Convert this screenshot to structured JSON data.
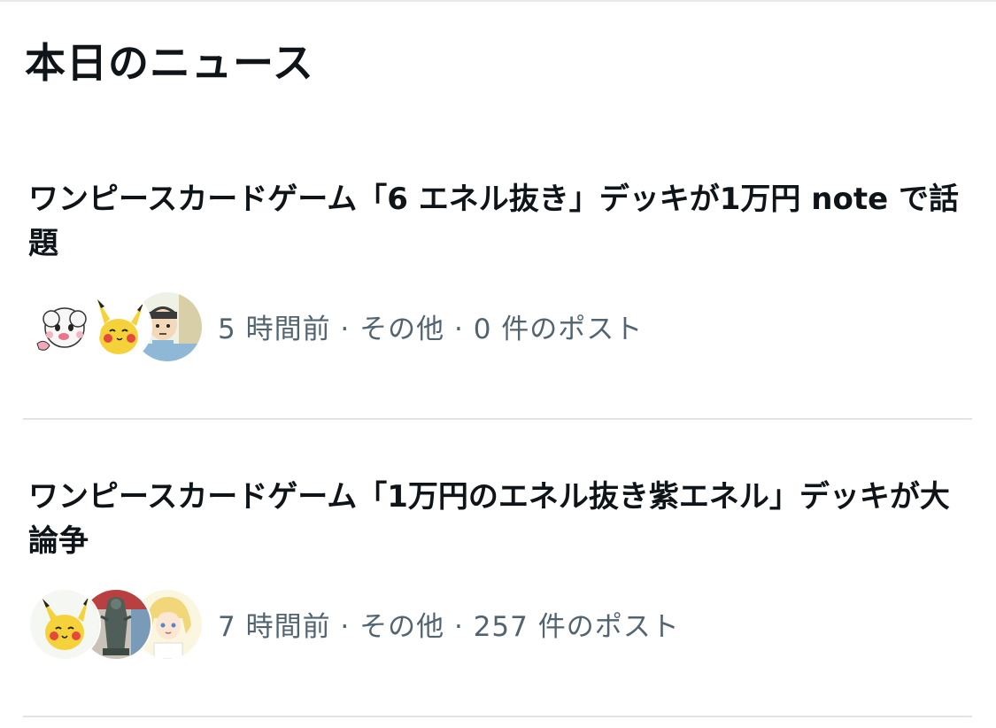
{
  "section": {
    "title": "本日のニュース"
  },
  "news": [
    {
      "headline": "ワンピースカードゲーム「6 エネル抜き」デッキが1万円 note で話題",
      "meta": "5 時間前 · その他 · 0 件のポスト",
      "avatars": [
        "cloud-character-avatar",
        "pikachu-avatar",
        "anime-boy-avatar"
      ]
    },
    {
      "headline": "ワンピースカードゲーム「1万円のエネル抜き紫エネル」デッキが大論争",
      "meta": "7 時間前 · その他 · 257 件のポスト",
      "avatars": [
        "pikachu-avatar",
        "figure-statue-avatar",
        "blonde-anime-girl-avatar"
      ]
    }
  ],
  "colors": {
    "text_primary": "#0f1419",
    "text_secondary": "#536471",
    "divider": "#e1e4e6",
    "background": "#ffffff"
  }
}
